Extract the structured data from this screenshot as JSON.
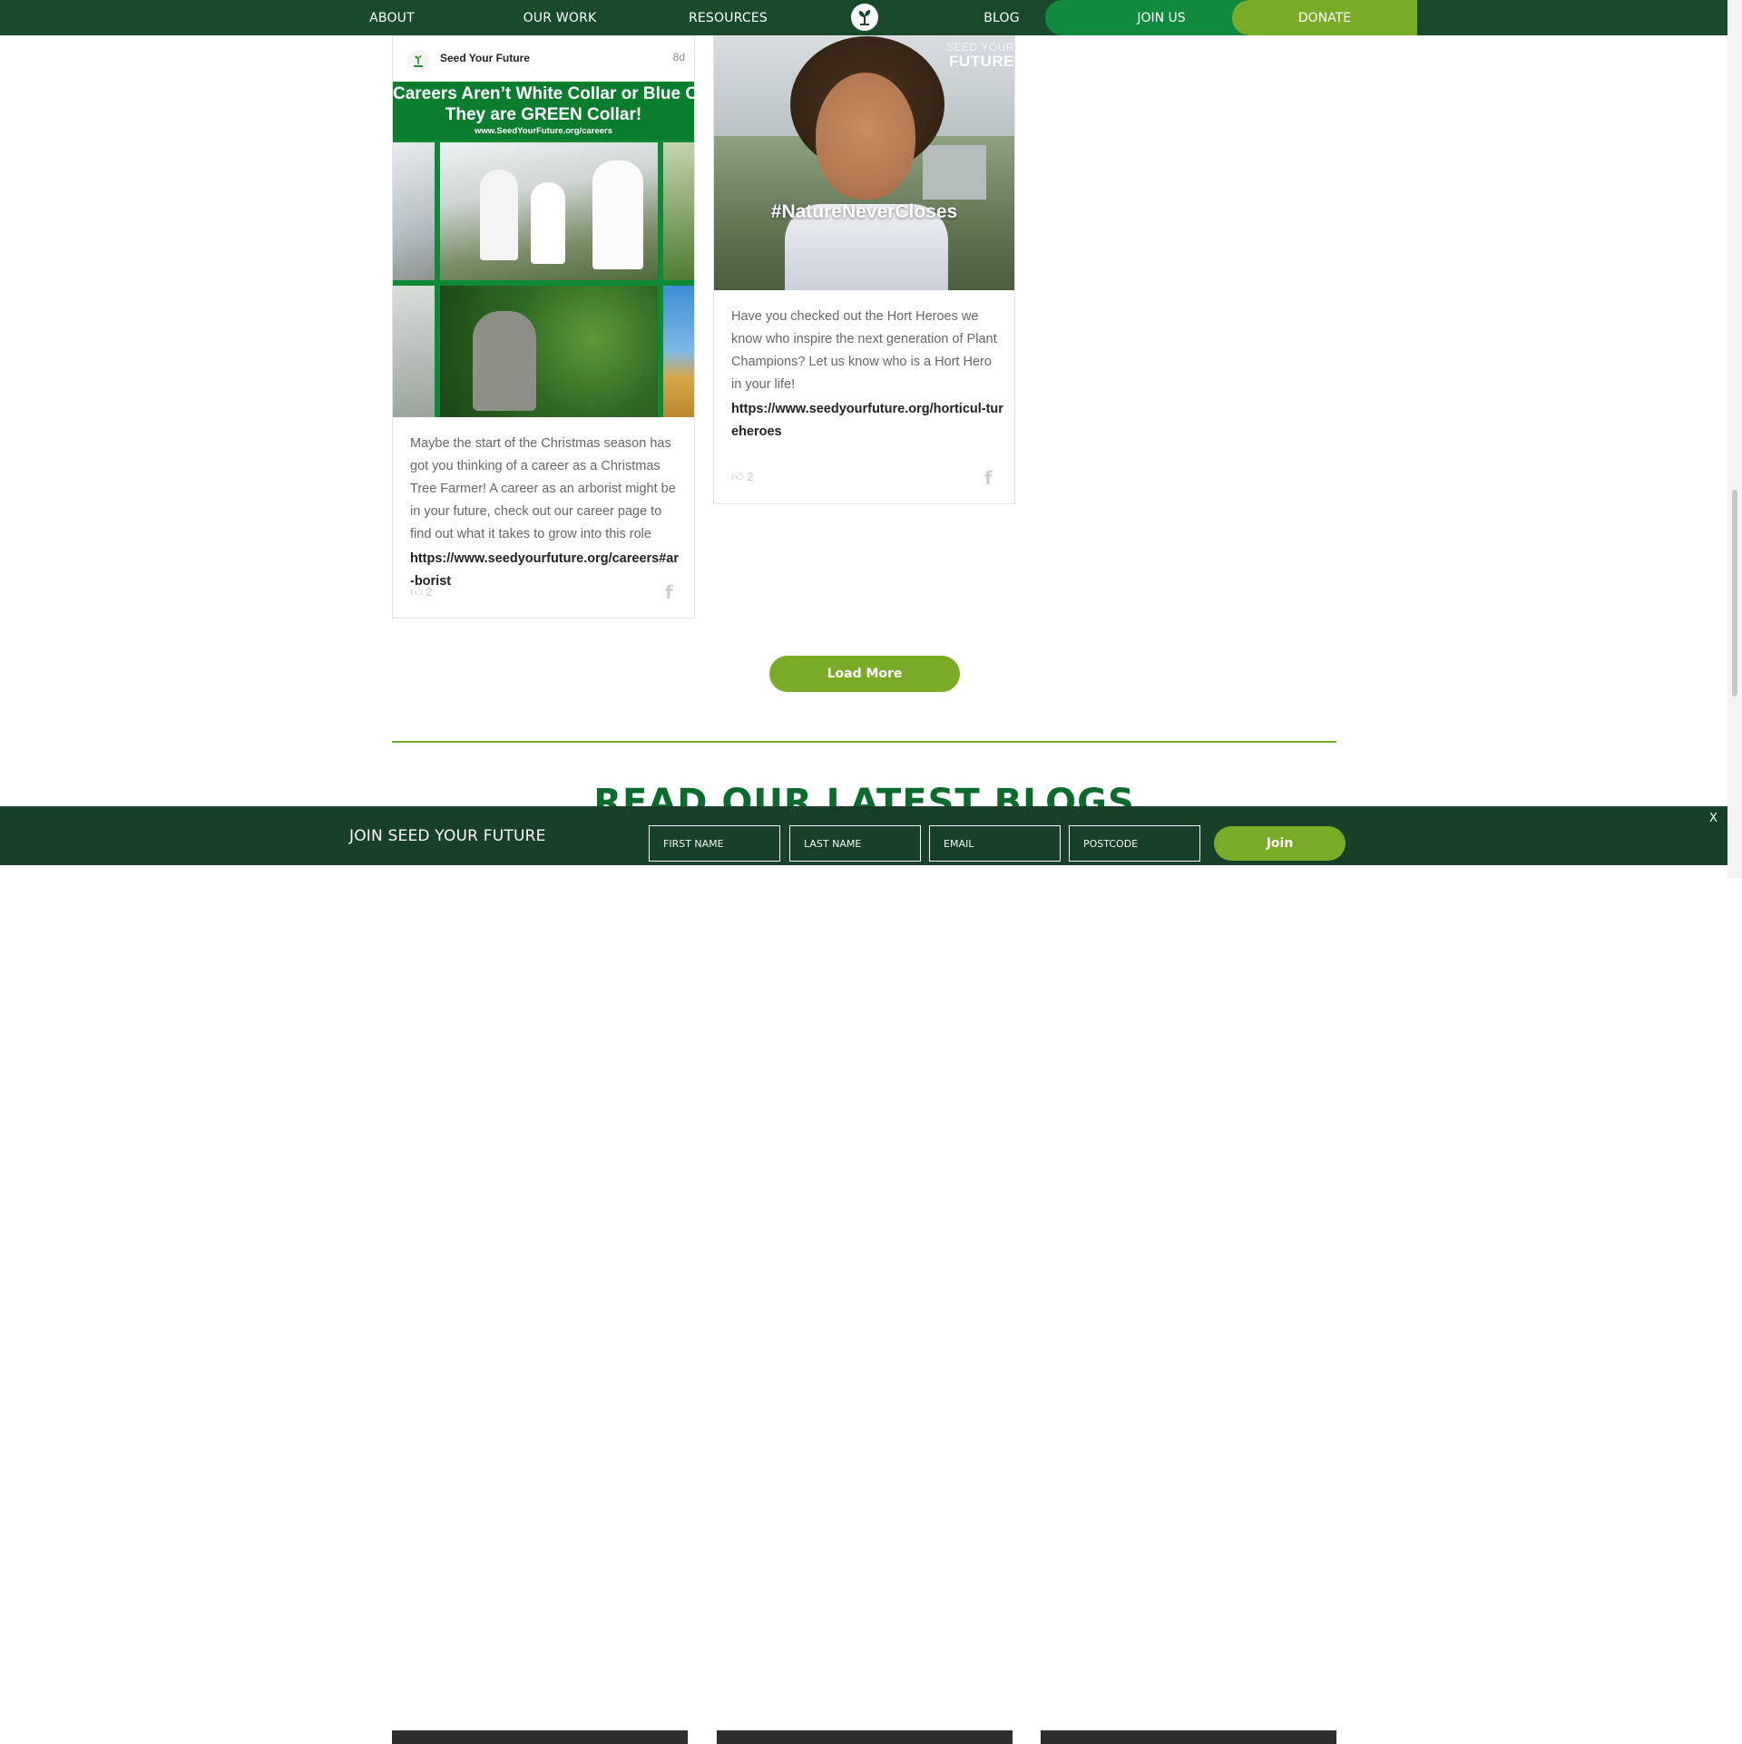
{
  "nav": {
    "items": [
      "ABOUT",
      "OUR WORK",
      "RESOURCES",
      "BLOG"
    ],
    "join_label": "JOIN US",
    "donate_label": "DONATE",
    "logo_icon": "seedling-icon"
  },
  "feed": {
    "posts": [
      {
        "author": "Seed Your Future",
        "time": "8d",
        "image": {
          "line1": "Careers Aren’t White Collar or Blue C",
          "line2": "They are GREEN Collar!",
          "url": "www.SeedYourFuture.org/careers"
        },
        "text": "Maybe the start of the Christmas season has got you thinking of a career as a Christmas Tree Farmer! A career as an arborist might be in your future, check out our career page to find out what it takes to grow into this role",
        "link": "https://www.seedyourfuture.org/careers#ar-borist",
        "likes": "2"
      },
      {
        "image": {
          "brand_small": "SEED YOUR",
          "brand": "FUTURE",
          "hashtag": "#NatureNeverCloses"
        },
        "text": "Have you checked out the Hort Heroes we know who inspire the next generation of Plant Champions? Let us know who is a Hort Hero in your life!",
        "link": "https://www.seedyourfuture.org/horticul-tureheroes",
        "likes": "2"
      }
    ],
    "load_more_label": "Load More"
  },
  "blogs": {
    "heading": "READ OUR LATEST BLOGS"
  },
  "join_bar": {
    "title": "JOIN SEED YOUR FUTURE",
    "first_name_placeholder": "FIRST NAME",
    "last_name_placeholder": "LAST NAME",
    "email_placeholder": "EMAIL",
    "postcode_placeholder": "POSTCODE",
    "join_label": "Join",
    "close_label": "X"
  },
  "colors": {
    "nav_bg": "#1a4a2c",
    "join_green": "#0f8a3f",
    "accent_green": "#7aab26",
    "heading_green": "#0a6b2d",
    "bar_bg": "#183f27"
  }
}
